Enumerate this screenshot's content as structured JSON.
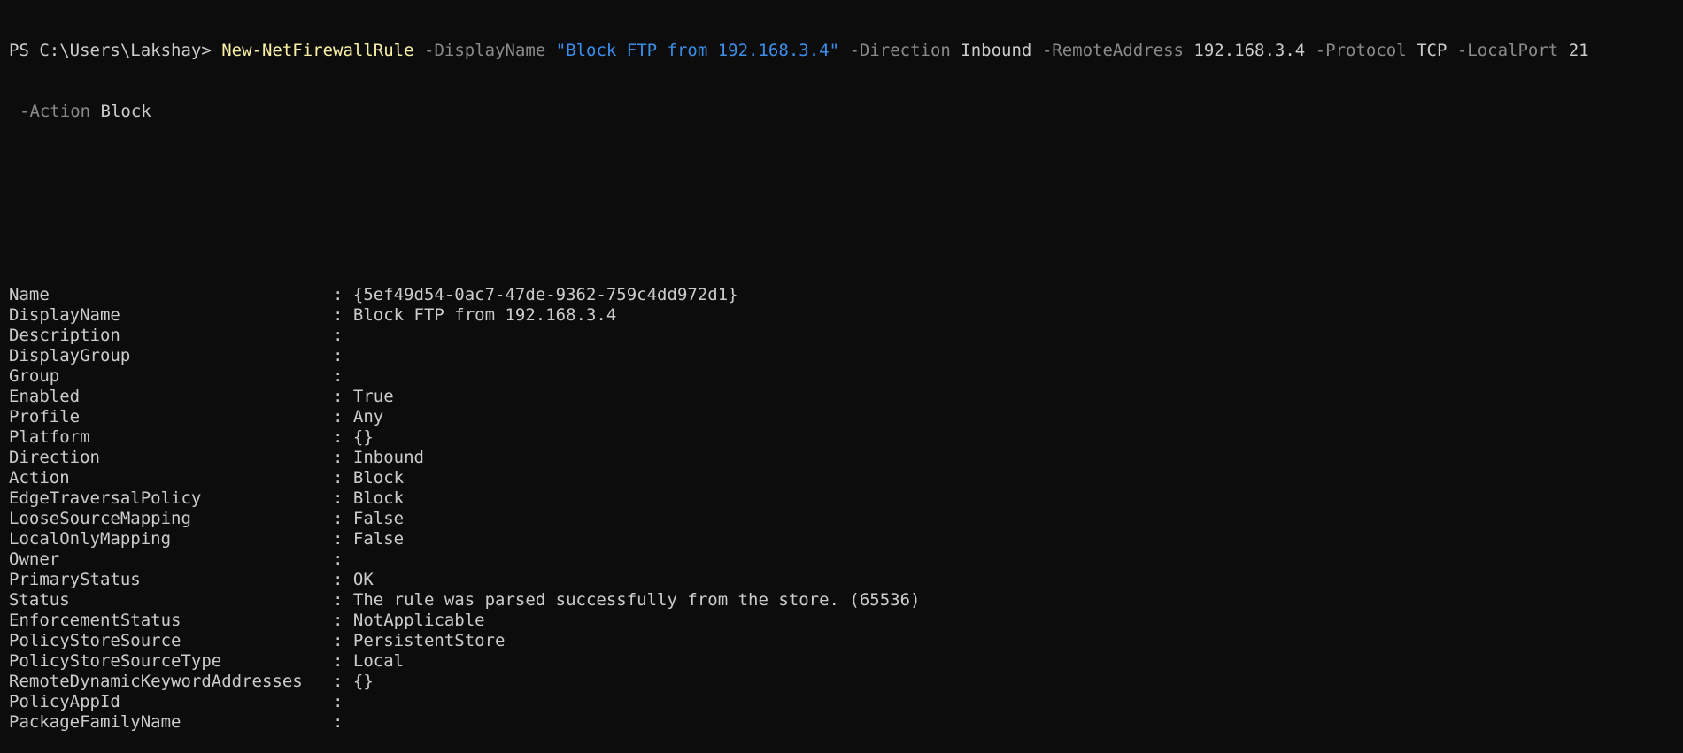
{
  "prompt": "PS C:\\Users\\Lakshay> ",
  "command": {
    "cmdlet": "New-NetFirewallRule",
    "tokens": [
      {
        "type": "param",
        "text": " -DisplayName "
      },
      {
        "type": "str",
        "text": "\"Block FTP from 192.168.3.4\""
      },
      {
        "type": "param",
        "text": " -Direction "
      },
      {
        "type": "arg",
        "text": "Inbound"
      },
      {
        "type": "param",
        "text": " -RemoteAddress "
      },
      {
        "type": "arg",
        "text": "192.168.3.4"
      },
      {
        "type": "param",
        "text": " -Protocol "
      },
      {
        "type": "arg",
        "text": "TCP"
      },
      {
        "type": "param",
        "text": " -LocalPort "
      },
      {
        "type": "arg",
        "text": "21"
      }
    ],
    "continuation": [
      {
        "type": "param",
        "text": "-Action "
      },
      {
        "type": "arg",
        "text": "Block"
      }
    ]
  },
  "separator": ": ",
  "rows": [
    {
      "key": "Name",
      "value": "{5ef49d54-0ac7-47de-9362-759c4dd972d1}"
    },
    {
      "key": "DisplayName",
      "value": "Block FTP from 192.168.3.4"
    },
    {
      "key": "Description",
      "value": ""
    },
    {
      "key": "DisplayGroup",
      "value": ""
    },
    {
      "key": "Group",
      "value": ""
    },
    {
      "key": "Enabled",
      "value": "True"
    },
    {
      "key": "Profile",
      "value": "Any"
    },
    {
      "key": "Platform",
      "value": "{}"
    },
    {
      "key": "Direction",
      "value": "Inbound"
    },
    {
      "key": "Action",
      "value": "Block"
    },
    {
      "key": "EdgeTraversalPolicy",
      "value": "Block"
    },
    {
      "key": "LooseSourceMapping",
      "value": "False"
    },
    {
      "key": "LocalOnlyMapping",
      "value": "False"
    },
    {
      "key": "Owner",
      "value": ""
    },
    {
      "key": "PrimaryStatus",
      "value": "OK"
    },
    {
      "key": "Status",
      "value": "The rule was parsed successfully from the store. (65536)"
    },
    {
      "key": "EnforcementStatus",
      "value": "NotApplicable"
    },
    {
      "key": "PolicyStoreSource",
      "value": "PersistentStore"
    },
    {
      "key": "PolicyStoreSourceType",
      "value": "Local"
    },
    {
      "key": "RemoteDynamicKeywordAddresses",
      "value": "{}"
    },
    {
      "key": "PolicyAppId",
      "value": ""
    },
    {
      "key": "PackageFamilyName",
      "value": ""
    }
  ],
  "colors": {
    "background": "#0c0c0c",
    "text": "#cccccc",
    "cmdlet": "#f9f1a5",
    "parameter": "#8a8a8a",
    "string": "#3b8eea"
  }
}
